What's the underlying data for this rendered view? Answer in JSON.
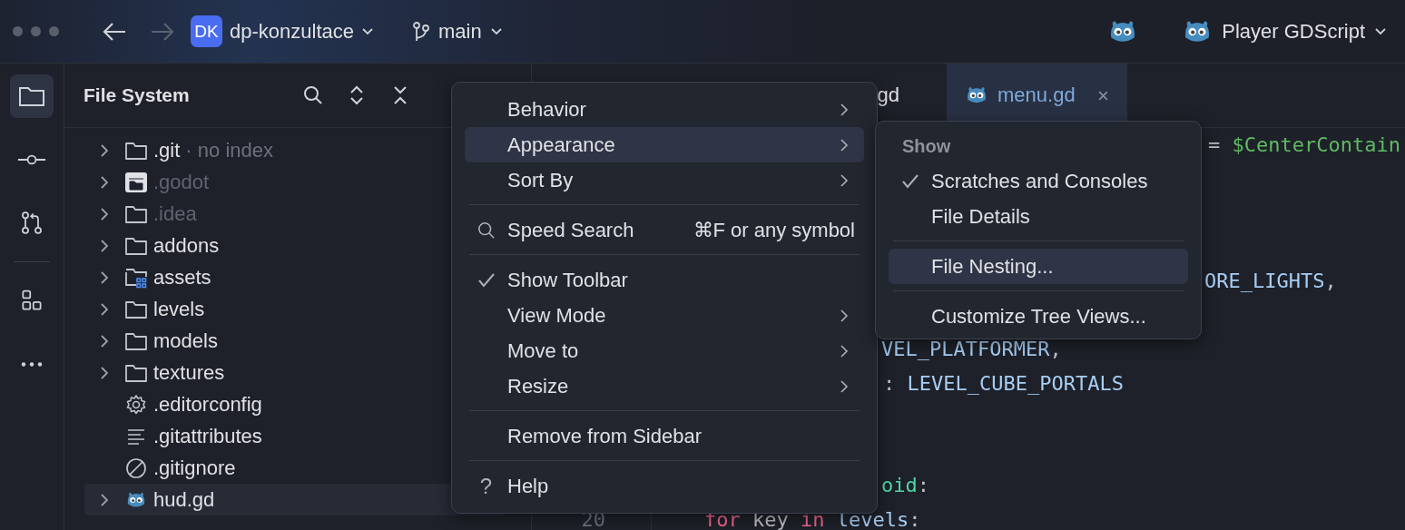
{
  "titlebar": {
    "project_badge": "DK",
    "project": "dp-konzultace",
    "branch": "main",
    "run_config": "Player GDScript"
  },
  "tool_strip": [
    {
      "kind": "folder",
      "selected": true
    },
    {
      "kind": "commit",
      "selected": false
    },
    {
      "kind": "pull-request",
      "selected": false
    },
    {
      "kind": "separator"
    },
    {
      "kind": "structure",
      "selected": false
    },
    {
      "kind": "more",
      "selected": false
    }
  ],
  "file_panel": {
    "title": "File System",
    "items": [
      {
        "name": ".git",
        "hint": "· no index",
        "kind": "folder",
        "dimmed": false,
        "expandable": true,
        "selected": false
      },
      {
        "name": ".godot",
        "kind": "excluded-folder",
        "dimmed": true,
        "expandable": true,
        "selected": false
      },
      {
        "name": ".idea",
        "kind": "folder",
        "dimmed": true,
        "expandable": true,
        "selected": false
      },
      {
        "name": "addons",
        "kind": "folder",
        "dimmed": false,
        "expandable": true,
        "selected": false
      },
      {
        "name": "assets",
        "kind": "resource-folder",
        "dimmed": false,
        "expandable": true,
        "selected": false
      },
      {
        "name": "levels",
        "kind": "folder",
        "dimmed": false,
        "expandable": true,
        "selected": false
      },
      {
        "name": "models",
        "kind": "folder",
        "dimmed": false,
        "expandable": true,
        "selected": false
      },
      {
        "name": "textures",
        "kind": "folder",
        "dimmed": false,
        "expandable": true,
        "selected": false
      },
      {
        "name": ".editorconfig",
        "kind": "config",
        "dimmed": false,
        "expandable": false,
        "selected": false
      },
      {
        "name": ".gitattributes",
        "kind": "text",
        "dimmed": false,
        "expandable": false,
        "selected": false
      },
      {
        "name": ".gitignore",
        "kind": "ignore",
        "dimmed": false,
        "expandable": false,
        "selected": false
      },
      {
        "name": "hud.gd",
        "kind": "script",
        "dimmed": false,
        "expandable": true,
        "selected": true
      }
    ]
  },
  "tabs": [
    {
      "label": "gd",
      "selected": false,
      "closable": false
    },
    {
      "label": "menu.gd",
      "selected": true,
      "closable": true
    }
  ],
  "code_lines": [
    {
      "tokens": [
        {
          "text": "= ",
          "kind": "plain"
        },
        {
          "text": "$CenterContain",
          "kind": "node"
        }
      ]
    },
    {
      "tokens": [
        {
          "text": "ORE_LIGHTS",
          "kind": "constant"
        },
        {
          "text": ",",
          "kind": "plain"
        }
      ]
    },
    {
      "tokens": [
        {
          "text": "VEL_PLATFORMER",
          "kind": "constant"
        },
        {
          "text": ",",
          "kind": "plain"
        }
      ]
    },
    {
      "tokens": [
        {
          "text": ": ",
          "kind": "plain"
        },
        {
          "text": "LEVEL_CUBE_PORTALS",
          "kind": "constant"
        }
      ]
    },
    {
      "tokens": [
        {
          "text": "oid",
          "kind": "type"
        },
        {
          "text": ":",
          "kind": "plain"
        }
      ]
    },
    {
      "number": "20",
      "tokens": [
        {
          "text": "for",
          "kind": "keyword"
        },
        {
          "text": " key ",
          "kind": "plain"
        },
        {
          "text": "in",
          "kind": "keyword"
        },
        {
          "text": " levels",
          "kind": "constant"
        },
        {
          "text": ":",
          "kind": "plain"
        }
      ]
    }
  ],
  "context_menu": {
    "items": [
      {
        "kind": "item",
        "label": "Behavior",
        "submenu": true,
        "checked": false,
        "selected": false
      },
      {
        "kind": "item",
        "label": "Appearance",
        "submenu": true,
        "checked": false,
        "selected": true
      },
      {
        "kind": "item",
        "label": "Sort By",
        "submenu": true,
        "checked": false,
        "selected": false
      },
      {
        "kind": "separator"
      },
      {
        "kind": "search",
        "label": "Speed Search",
        "shortcut": "⌘F or any symbol",
        "submenu": false,
        "checked": false,
        "selected": false
      },
      {
        "kind": "separator"
      },
      {
        "kind": "item",
        "label": "Show Toolbar",
        "submenu": false,
        "checked": true,
        "selected": false
      },
      {
        "kind": "item",
        "label": "View Mode",
        "submenu": true,
        "checked": false,
        "selected": false
      },
      {
        "kind": "item",
        "label": "Move to",
        "submenu": true,
        "checked": false,
        "selected": false
      },
      {
        "kind": "item",
        "label": "Resize",
        "submenu": true,
        "checked": false,
        "selected": false
      },
      {
        "kind": "separator"
      },
      {
        "kind": "item",
        "label": "Remove from Sidebar",
        "submenu": false,
        "checked": false,
        "selected": false
      },
      {
        "kind": "separator"
      },
      {
        "kind": "help",
        "glyph": "?",
        "label": "Help",
        "submenu": false,
        "checked": false,
        "selected": false
      }
    ]
  },
  "submenu": {
    "header": "Show",
    "items": [
      {
        "kind": "item",
        "label": "Scratches and Consoles",
        "checked": true,
        "selected": false
      },
      {
        "kind": "item",
        "label": "File Details",
        "checked": false,
        "selected": false
      },
      {
        "kind": "separator"
      },
      {
        "kind": "item",
        "label": "File Nesting...",
        "checked": false,
        "selected": true
      },
      {
        "kind": "separator"
      },
      {
        "kind": "item",
        "label": "Customize Tree Views...",
        "checked": false,
        "selected": false
      }
    ]
  }
}
